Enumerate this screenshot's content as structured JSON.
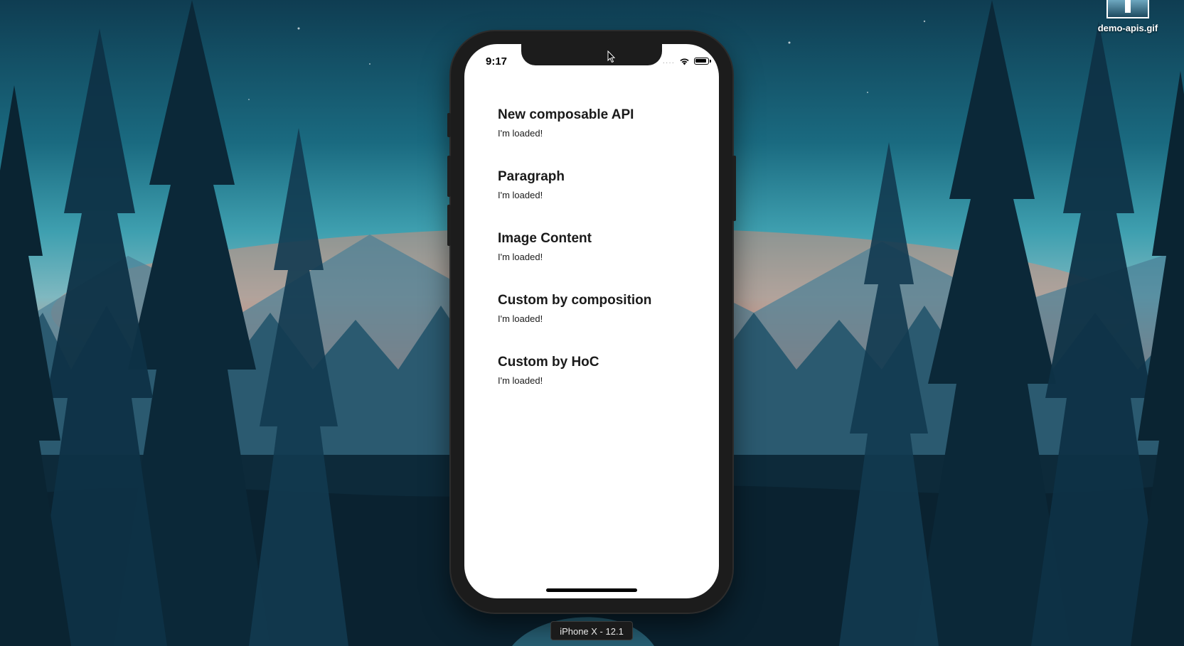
{
  "desktop": {
    "file": {
      "label": "demo-apis.gif",
      "icon": "gif-file-icon"
    }
  },
  "simulator": {
    "device_label": "iPhone X - 12.1",
    "status_bar": {
      "time": "9:17",
      "signal": "····",
      "icons": [
        "wifi-icon",
        "battery-icon"
      ]
    },
    "sections": [
      {
        "title": "New composable API",
        "text": "I'm loaded!"
      },
      {
        "title": "Paragraph",
        "text": "I'm loaded!"
      },
      {
        "title": "Image Content",
        "text": "I'm loaded!"
      },
      {
        "title": "Custom by composition",
        "text": "I'm loaded!"
      },
      {
        "title": "Custom by HoC",
        "text": "I'm loaded!"
      }
    ]
  },
  "colors": {
    "screen_background": "#ffffff",
    "text": "#1a1a1a",
    "device_frame": "#1c1c1c"
  }
}
